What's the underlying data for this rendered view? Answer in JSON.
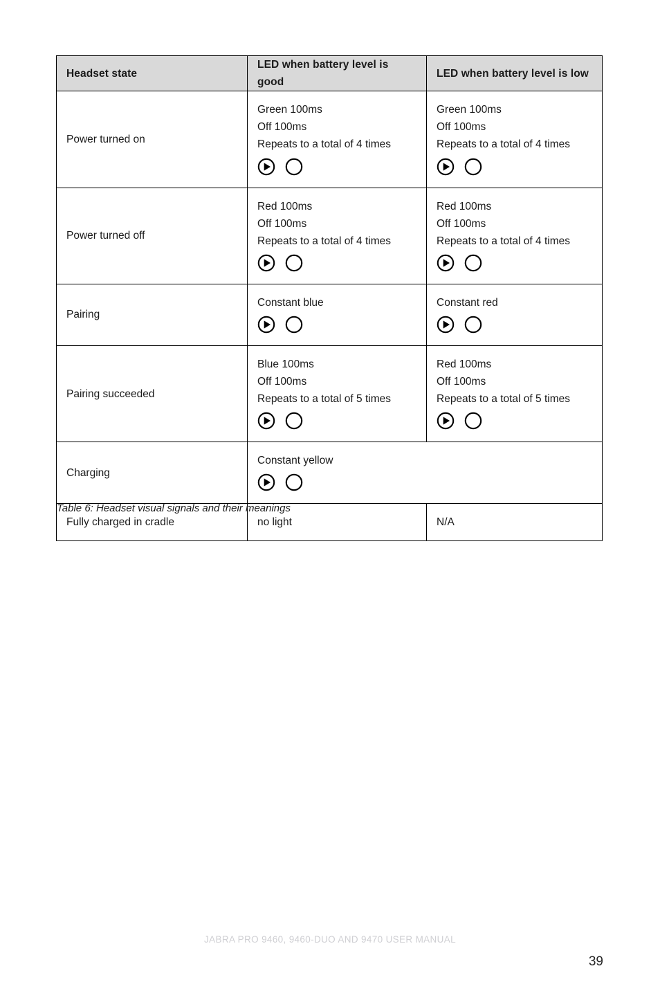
{
  "document": {
    "footer_text": "JABRA PRO 9460, 9460-DUO AND 9470 USER MANUAL",
    "page_number": "39",
    "caption": "Table 6: Headset visual signals and their meanings"
  },
  "table": {
    "headers": {
      "col1": "Headset state",
      "col2": "LED when battery level is good",
      "col3": "LED when battery level is low"
    },
    "rows": [
      {
        "state": "Power turned on",
        "good": {
          "lines": [
            "Green 100ms",
            "Off 100ms",
            "Repeats to a total of 4 times"
          ],
          "icons": [
            "play-circle-icon",
            "circle-outline-icon"
          ]
        },
        "low": {
          "lines": [
            "Green 100ms",
            "Off 100ms",
            "Repeats to a total of 4 times"
          ],
          "icons": [
            "play-circle-icon",
            "circle-outline-icon"
          ]
        }
      },
      {
        "state": "Power turned off",
        "good": {
          "lines": [
            "Red 100ms",
            "Off 100ms",
            "Repeats to a total of 4 times"
          ],
          "icons": [
            "play-circle-icon",
            "circle-outline-icon"
          ]
        },
        "low": {
          "lines": [
            "Red 100ms",
            "Off 100ms",
            "Repeats to a total of 4 times"
          ],
          "icons": [
            "play-circle-icon",
            "circle-outline-icon"
          ]
        }
      },
      {
        "state": "Pairing",
        "good": {
          "lines": [
            "Constant blue"
          ],
          "icons": [
            "play-circle-icon",
            "circle-outline-icon"
          ]
        },
        "low": {
          "lines": [
            "Constant red"
          ],
          "icons": [
            "play-circle-icon",
            "circle-outline-icon"
          ]
        }
      },
      {
        "state": "Pairing succeeded",
        "good": {
          "lines": [
            "Blue 100ms",
            "Off 100ms",
            "Repeats to a total of 5 times"
          ],
          "icons": [
            "play-circle-icon",
            "circle-outline-icon"
          ]
        },
        "low": {
          "lines": [
            "Red 100ms",
            "Off 100ms",
            "Repeats to a total of 5 times"
          ],
          "icons": [
            "play-circle-icon",
            "circle-outline-icon"
          ]
        }
      },
      {
        "state": "Charging",
        "merged": true,
        "good": {
          "lines": [
            "Constant yellow"
          ],
          "icons": [
            "play-circle-icon",
            "circle-outline-icon"
          ]
        }
      },
      {
        "state": "Fully charged in cradle",
        "good": {
          "lines": [
            "no light"
          ],
          "icons": []
        },
        "low": {
          "lines": [
            "N/A"
          ],
          "icons": []
        }
      }
    ]
  },
  "colors": {
    "header_background": "#d9d9d9",
    "border": "#000000",
    "text": "#1a1a1a",
    "footer_text": "#cfcfd3"
  }
}
